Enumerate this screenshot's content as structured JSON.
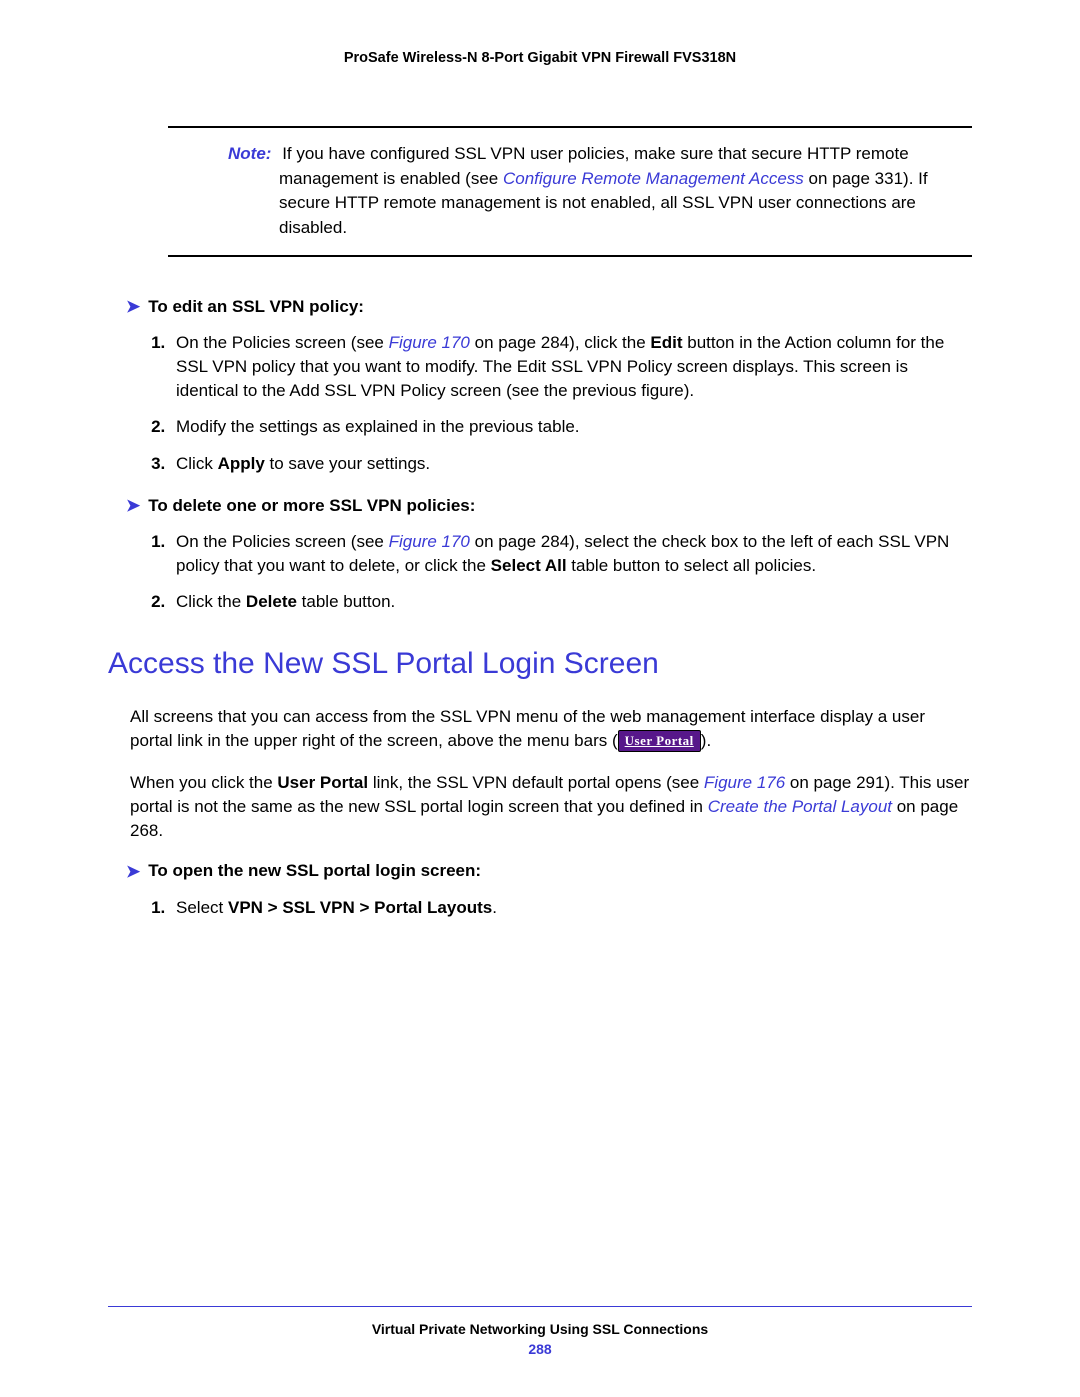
{
  "header": {
    "product": "ProSafe Wireless-N 8-Port Gigabit VPN Firewall FVS318N"
  },
  "note": {
    "label": "Note:",
    "text_before_link": "If you have configured SSL VPN user policies, make sure that secure HTTP remote management is enabled (see ",
    "link_text": "Configure Remote Management Access",
    "text_after_link": " on page 331). If secure HTTP remote management is not enabled, all SSL VPN user connections are disabled."
  },
  "proc1": {
    "heading": "To edit an SSL VPN policy:",
    "step1_a": "On the Policies screen (see ",
    "step1_link": "Figure 170",
    "step1_b": " on page 284), click the ",
    "step1_bold": "Edit",
    "step1_c": " button in the Action column for the SSL VPN policy that you want to modify. The Edit SSL VPN Policy screen displays. This screen is identical to the Add SSL VPN Policy screen (see the previous figure).",
    "step2": "Modify the settings as explained in the previous table.",
    "step3_a": "Click ",
    "step3_bold": "Apply",
    "step3_b": " to save your settings."
  },
  "proc2": {
    "heading": "To delete one or more SSL VPN policies:",
    "step1_a": "On the Policies screen (see ",
    "step1_link": "Figure 170",
    "step1_b": " on page 284), select the check box to the left of each SSL VPN policy that you want to delete, or click the ",
    "step1_bold": "Select All",
    "step1_c": " table button to select all policies.",
    "step2_a": "Click the ",
    "step2_bold": "Delete",
    "step2_b": " table button."
  },
  "section": {
    "title": "Access the New SSL Portal Login Screen"
  },
  "para1": {
    "text": "All screens that you can access from the SSL VPN menu of the web management interface display a user portal link in the upper right of the screen, above the menu bars (",
    "badge": "User Portal",
    "after": ")."
  },
  "para2": {
    "a": "When you click the ",
    "bold1": "User Portal",
    "b": " link, the SSL VPN default portal opens (see ",
    "link1": "Figure 176",
    "c": " on page 291). This user portal is not the same as the new SSL portal login screen that you defined in ",
    "link2": "Create the Portal Layout",
    "d": " on page 268."
  },
  "proc3": {
    "heading": "To open the new SSL portal login screen:",
    "step1_a": "Select ",
    "step1_bold": "VPN > SSL VPN > Portal Layouts",
    "step1_b": "."
  },
  "footer": {
    "chapter": "Virtual Private Networking Using SSL Connections",
    "page": "288"
  }
}
